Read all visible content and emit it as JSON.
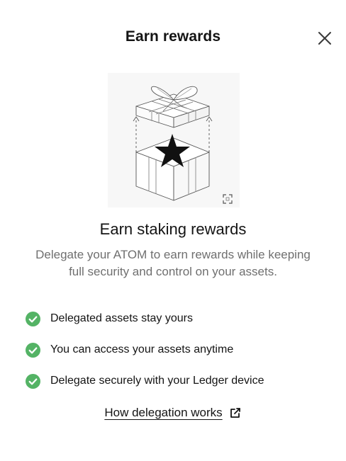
{
  "header": {
    "title": "Earn rewards",
    "close_icon": "close-icon"
  },
  "illustration": {
    "icon": "gift-box-star-illustration",
    "expand_icon": "expand-icon"
  },
  "main": {
    "title": "Earn staking rewards",
    "description": "Delegate your ATOM to earn rewards while keeping\nfull security  and control on your assets."
  },
  "benefits": [
    {
      "icon": "check-circle-icon",
      "text": "Delegated assets stay yours"
    },
    {
      "icon": "check-circle-icon",
      "text": "You can access your assets anytime"
    },
    {
      "icon": "check-circle-icon",
      "text": "Delegate securely with your Ledger device"
    }
  ],
  "link": {
    "label": "How delegation works",
    "icon": "external-link-icon"
  },
  "colors": {
    "success": "#54b365",
    "text": "#141414",
    "muted": "#6f6f6f"
  }
}
